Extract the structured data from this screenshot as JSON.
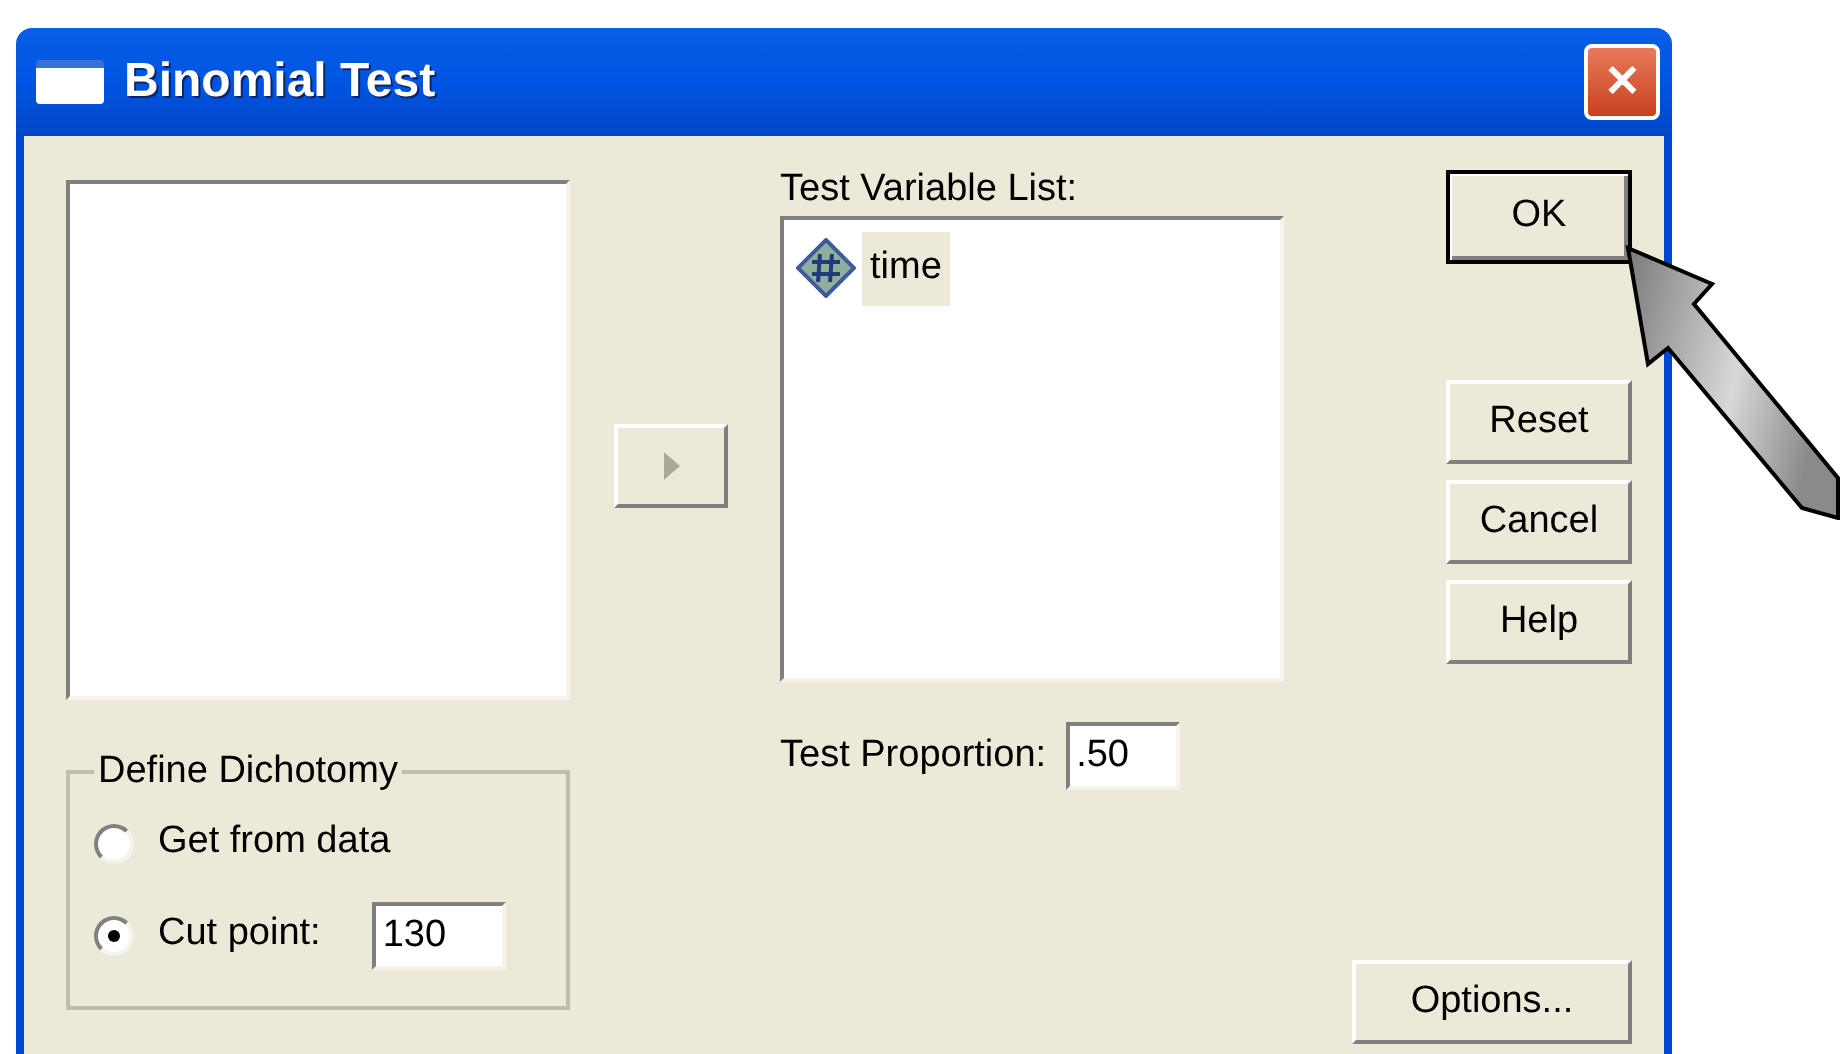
{
  "window": {
    "title": "Binomial Test",
    "close_glyph": "✕"
  },
  "move_button": {
    "disabled": true
  },
  "test_variable_list": {
    "label": "Test Variable List:",
    "items": [
      {
        "name": "time",
        "selected": true
      }
    ]
  },
  "define_dichotomy": {
    "title": "Define Dichotomy",
    "options": [
      {
        "label": "Get from data",
        "selected": false
      },
      {
        "label": "Cut point:",
        "selected": true
      }
    ],
    "cut_point": "130"
  },
  "test_proportion": {
    "label": "Test Proportion:",
    "value": ".50"
  },
  "buttons": [
    {
      "label": "OK",
      "default": true
    },
    {
      "label": "Reset",
      "default": false
    },
    {
      "label": "Cancel",
      "default": false
    },
    {
      "label": "Help",
      "default": false
    }
  ],
  "options_button": {
    "label": "Options..."
  }
}
